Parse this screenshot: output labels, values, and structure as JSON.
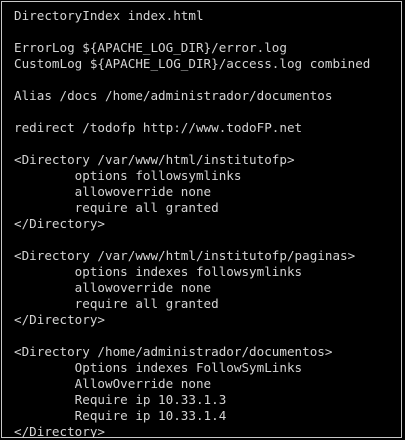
{
  "terminal": {
    "lines": [
      "DirectoryIndex index.html",
      "",
      "ErrorLog ${APACHE_LOG_DIR}/error.log",
      "CustomLog ${APACHE_LOG_DIR}/access.log combined",
      "",
      "Alias /docs /home/administrador/documentos",
      "",
      "redirect /todofp http://www.todoFP.net",
      "",
      "<Directory /var/www/html/institutofp>",
      "        options followsymlinks",
      "        allowoverride none",
      "        require all granted",
      "</Directory>",
      "",
      "<Directory /var/www/html/institutofp/paginas>",
      "        options indexes followsymlinks",
      "        allowoverride none",
      "        require all granted",
      "</Directory>",
      "",
      "<Directory /home/administrador/documentos>",
      "        Options indexes FollowSymLinks",
      "        AllowOverride none",
      "        Require ip 10.33.1.3",
      "        Require ip 10.33.1.4",
      "</Directory>"
    ]
  }
}
